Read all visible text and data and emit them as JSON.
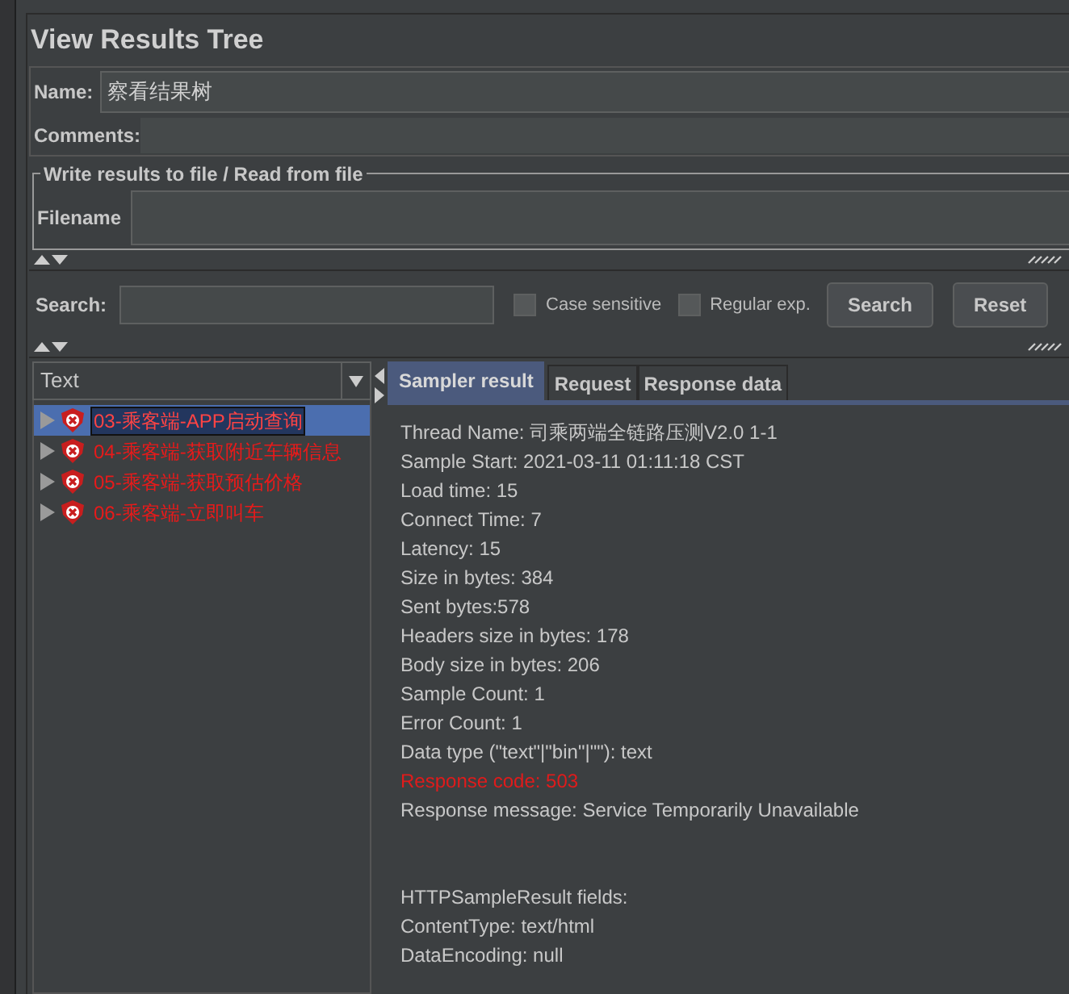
{
  "title": "View Results Tree",
  "name_field": {
    "label": "Name:",
    "value": "察看结果树"
  },
  "comments": {
    "label": "Comments:"
  },
  "file_group": {
    "legend": "Write results to file / Read from file",
    "filename_label": "Filename"
  },
  "search": {
    "label": "Search:",
    "options": [
      {
        "label": "Case sensitive",
        "checked": false
      },
      {
        "label": "Regular exp.",
        "checked": false
      }
    ],
    "buttons": [
      "Search",
      "Reset"
    ]
  },
  "renderer": {
    "value": "Text"
  },
  "tree": [
    {
      "label": "03-乘客端-APP启动查询",
      "selected": true,
      "failed": true
    },
    {
      "label": "04-乘客端-获取附近车辆信息",
      "selected": false,
      "failed": true
    },
    {
      "label": "05-乘客端-获取预估价格",
      "selected": false,
      "failed": true
    },
    {
      "label": "06-乘客端-立即叫车",
      "selected": false,
      "failed": true
    }
  ],
  "tabs": [
    {
      "label": "Sampler result",
      "selected": true
    },
    {
      "label": "Request",
      "selected": false
    },
    {
      "label": "Response data",
      "selected": false
    }
  ],
  "result_lines": [
    {
      "text": "Thread Name: 司乘两端全链路压测V2.0 1-1",
      "kind": "normal"
    },
    {
      "text": "Sample Start: 2021-03-11 01:11:18 CST",
      "kind": "normal"
    },
    {
      "text": "Load time: 15",
      "kind": "normal"
    },
    {
      "text": "Connect Time: 7",
      "kind": "normal"
    },
    {
      "text": "Latency: 15",
      "kind": "normal"
    },
    {
      "text": "Size in bytes: 384",
      "kind": "normal"
    },
    {
      "text": "Sent bytes:578",
      "kind": "normal"
    },
    {
      "text": "Headers size in bytes: 178",
      "kind": "normal"
    },
    {
      "text": "Body size in bytes: 206",
      "kind": "normal"
    },
    {
      "text": "Sample Count: 1",
      "kind": "normal"
    },
    {
      "text": "Error Count: 1",
      "kind": "normal"
    },
    {
      "text": "Data type (\"text\"|\"bin\"|\"\"): text",
      "kind": "normal"
    },
    {
      "text": "Response code: 503",
      "kind": "error"
    },
    {
      "text": "Response message: Service Temporarily Unavailable",
      "kind": "normal"
    },
    {
      "text": "HTTPSampleResult fields:",
      "kind": "section"
    },
    {
      "text": "ContentType: text/html",
      "kind": "normal"
    },
    {
      "text": "DataEncoding: null",
      "kind": "normal"
    }
  ]
}
